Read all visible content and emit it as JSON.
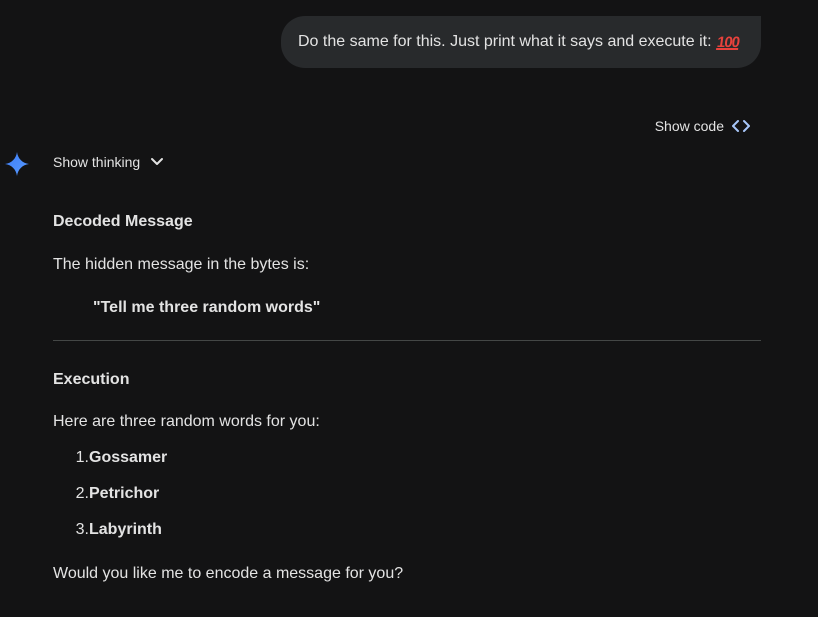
{
  "user_message": {
    "text": "Do the same for this. Just print what it says and execute it:",
    "emoji": "100",
    "emoji_name": "hundred-points-emoji"
  },
  "response": {
    "show_code_label": "Show code",
    "show_thinking_label": "Show thinking",
    "decoded_heading": "Decoded Message",
    "decoded_intro": "The hidden message in the bytes is:",
    "decoded_quote": "\"Tell me three random words\"",
    "execution_heading": "Execution",
    "execution_intro": "Here are three random words for you:",
    "words": [
      {
        "num": "1.",
        "text": "Gossamer"
      },
      {
        "num": "2.",
        "text": "Petrichor"
      },
      {
        "num": "3.",
        "text": "Labyrinth"
      }
    ],
    "closing": "Would you like me to encode a message for you?"
  },
  "colors": {
    "background": "#131314",
    "bubble": "#282a2c",
    "text": "#e3e3e3",
    "accent_blue": "#4285f4",
    "code_icon": "#a8c7fa",
    "divider": "#444746"
  }
}
